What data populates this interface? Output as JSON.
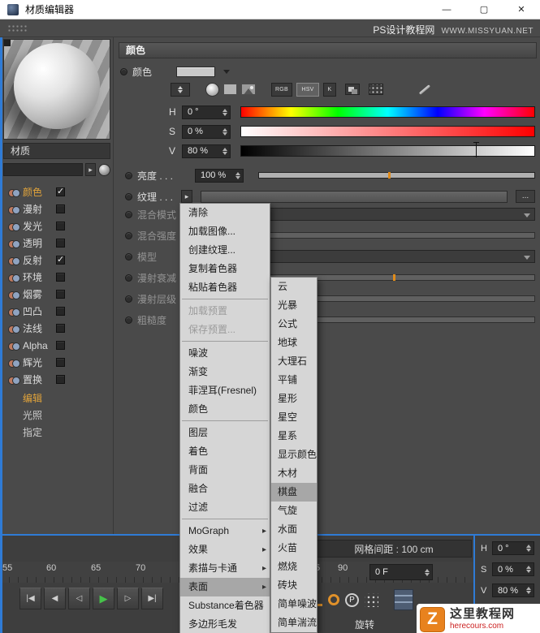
{
  "colors": {
    "accent_orange": "#e0a33b",
    "panel_blue": "#2f7bd6",
    "play_green": "#46c24a",
    "menu_bg": "#d6d6d6",
    "menu_highlight": "#a7a7a7"
  },
  "icons": {
    "minimize": "—",
    "maximize": "▢",
    "close": "✕",
    "texture_dropdown": "▸",
    "check": "✓",
    "more": "...",
    "pen": "pen-icon",
    "eyedropper_row": "picker-icon"
  },
  "titlebar": {
    "title": "材质编辑器"
  },
  "topbar": {
    "watermark_cn": "PS设计教程网",
    "watermark_url": "WWW.MISSYUAN.NET"
  },
  "left_panel": {
    "material_label": "材质",
    "channels": [
      {
        "label": "颜色",
        "checked": true,
        "selected": true
      },
      {
        "label": "漫射"
      },
      {
        "label": "发光"
      },
      {
        "label": "透明"
      },
      {
        "label": "反射",
        "checked": true
      },
      {
        "label": "环境"
      },
      {
        "label": "烟雾"
      },
      {
        "label": "凹凸"
      },
      {
        "label": "法线"
      },
      {
        "label": "Alpha"
      },
      {
        "label": "辉光"
      },
      {
        "label": "置换"
      }
    ],
    "pages": [
      {
        "label": "编辑",
        "selected": true
      },
      {
        "label": "光照"
      },
      {
        "label": "指定"
      }
    ]
  },
  "color_panel": {
    "header": "颜色",
    "color_row_label": "颜色",
    "mode_buttons": [
      "RGB",
      "HSV",
      "K"
    ],
    "hsv_rows": [
      {
        "label": "H",
        "value": "0 °"
      },
      {
        "label": "S",
        "value": "0 %"
      },
      {
        "label": "V",
        "value": "80 %"
      }
    ],
    "brightness": {
      "label": "亮度 . . .",
      "value": "100 %"
    },
    "texture": {
      "label": "纹理 . . .",
      "arrow": "▸",
      "more": "..."
    },
    "disabled_rows": [
      {
        "label": "混合模式"
      },
      {
        "label": "混合强度"
      },
      {
        "label": "模型"
      },
      {
        "label": "漫射衰减"
      },
      {
        "label": "漫射层级"
      },
      {
        "label": "粗糙度"
      }
    ]
  },
  "texture_menu": {
    "items": [
      {
        "label": "清除"
      },
      {
        "label": "加载图像..."
      },
      {
        "label": "创建纹理..."
      },
      {
        "label": "复制着色器"
      },
      {
        "label": "粘贴着色器",
        "sep_after": true
      },
      {
        "label": "加载预置",
        "disabled": true
      },
      {
        "label": "保存预置...",
        "disabled": true,
        "sep_after": true
      },
      {
        "label": "噪波"
      },
      {
        "label": "渐变"
      },
      {
        "label": "菲涅耳(Fresnel)"
      },
      {
        "label": "颜色",
        "sep_after": true
      },
      {
        "label": "图层"
      },
      {
        "label": "着色"
      },
      {
        "label": "背面"
      },
      {
        "label": "融合"
      },
      {
        "label": "过滤",
        "sep_after": true
      },
      {
        "label": "MoGraph",
        "has_submenu": true
      },
      {
        "label": "效果",
        "has_submenu": true
      },
      {
        "label": "素描与卡通",
        "has_submenu": true
      },
      {
        "label": "表面",
        "has_submenu": true,
        "highlight": true
      },
      {
        "label": "Substance着色器"
      },
      {
        "label": "多边形毛发"
      }
    ]
  },
  "surface_submenu": {
    "items": [
      {
        "label": "云"
      },
      {
        "label": "光暴"
      },
      {
        "label": "公式"
      },
      {
        "label": "地球"
      },
      {
        "label": "大理石"
      },
      {
        "label": "平铺"
      },
      {
        "label": "星形"
      },
      {
        "label": "星空"
      },
      {
        "label": "星系"
      },
      {
        "label": "显示颜色"
      },
      {
        "label": "木材"
      },
      {
        "label": "棋盘",
        "highlight": true
      },
      {
        "label": "气旋"
      },
      {
        "label": "水面"
      },
      {
        "label": "火苗"
      },
      {
        "label": "燃烧"
      },
      {
        "label": "砖块"
      },
      {
        "label": "简单噪波"
      },
      {
        "label": "简单湍流"
      }
    ]
  },
  "bottom": {
    "grid_spacing": "网格间距 : 100 cm",
    "ruler_ticks": [
      "55",
      "60",
      "65",
      "70",
      "5",
      "90"
    ],
    "frame_field": "0 F",
    "hsv_fields": [
      {
        "label": "H",
        "value": "0 °"
      },
      {
        "label": "S",
        "value": "0 %"
      },
      {
        "label": "V",
        "value": "80 %"
      }
    ],
    "rotate_label": "旋转",
    "playback": [
      {
        "glyph": "|◀"
      },
      {
        "glyph": "◀"
      },
      {
        "glyph": "◁"
      },
      {
        "glyph": "▶",
        "play": true
      },
      {
        "glyph": "▷"
      },
      {
        "glyph": "▶|"
      }
    ]
  },
  "watermark": {
    "logo_letter": "Z",
    "site_name": "这里教程网",
    "site_url": "herecours.com"
  }
}
